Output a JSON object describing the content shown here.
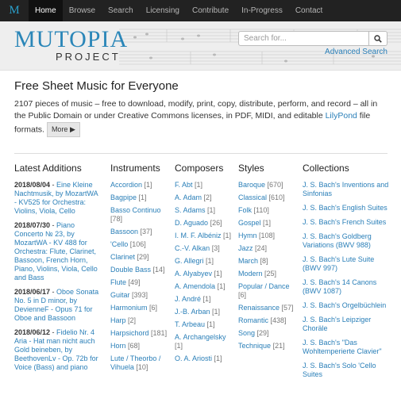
{
  "nav": {
    "brand": "M",
    "items": [
      {
        "label": "Home",
        "active": true
      },
      {
        "label": "Browse"
      },
      {
        "label": "Search"
      },
      {
        "label": "Licensing"
      },
      {
        "label": "Contribute"
      },
      {
        "label": "In-Progress"
      },
      {
        "label": "Contact"
      }
    ]
  },
  "header": {
    "logo_main": "MUTOPIA",
    "logo_sub": "PROJECT",
    "search_placeholder": "Search for...",
    "advanced_search": "Advanced Search"
  },
  "intro": {
    "title": "Free Sheet Music for Everyone",
    "text": "2107 pieces of music – free to download, modify, print, copy, distribute, perform, and record – all in the Public Domain or under Creative Commons licenses, in PDF, MIDI, and editable ",
    "link": "LilyPond",
    "text_end": " file formats.",
    "more": "More"
  },
  "latest": {
    "heading": "Latest Additions",
    "items": [
      {
        "date": "2018/08/04",
        "sep": " - ",
        "title": "Eine Kleine Nachtmusik, by MozartWA - KV525 for Orchestra: Violins, Viola, Cello"
      },
      {
        "date": "2018/07/30",
        "sep": " - ",
        "title": "Piano Concerto № 23, by MozartWA - KV 488 for Orchestra: Flute, Clarinet, Bassoon, French Horn, Piano, Violins, Viola, Cello and Bass"
      },
      {
        "date": "2018/06/17",
        "sep": " - ",
        "title": "Oboe Sonata No. 5 in D minor, by DevienneF - Opus 71 for Oboe and Bassoon"
      },
      {
        "date": "2018/06/12",
        "sep": " - ",
        "title": "Fidelio Nr. 4 Aria - Hat man nicht auch Gold beineben, by BeethovenLv - Op. 72b for Voice (Bass) and piano"
      }
    ]
  },
  "instruments": {
    "heading": "Instruments",
    "items": [
      {
        "name": "Accordion",
        "count": "[1]"
      },
      {
        "name": "Bagpipe",
        "count": "[1]"
      },
      {
        "name": "Basso Continuo",
        "count": "[78]"
      },
      {
        "name": "Bassoon",
        "count": "[37]"
      },
      {
        "name": "'Cello",
        "count": "[106]"
      },
      {
        "name": "Clarinet",
        "count": "[29]"
      },
      {
        "name": "Double Bass",
        "count": "[14]"
      },
      {
        "name": "Flute",
        "count": "[49]"
      },
      {
        "name": "Guitar",
        "count": "[393]"
      },
      {
        "name": "Harmonium",
        "count": "[6]"
      },
      {
        "name": "Harp",
        "count": "[2]"
      },
      {
        "name": "Harpsichord",
        "count": "[181]"
      },
      {
        "name": "Horn",
        "count": "[68]"
      },
      {
        "name": "Lute / Theorbo / Vihuela",
        "count": "[10]"
      }
    ]
  },
  "composers": {
    "heading": "Composers",
    "items": [
      {
        "name": "F. Abt",
        "count": "[1]"
      },
      {
        "name": "A. Adam",
        "count": "[2]"
      },
      {
        "name": "S. Adams",
        "count": "[1]"
      },
      {
        "name": "D. Aguado",
        "count": "[26]"
      },
      {
        "name": "I. M. F. Albéniz",
        "count": "[1]"
      },
      {
        "name": "C.-V. Alkan",
        "count": "[3]"
      },
      {
        "name": "G. Allegri",
        "count": "[1]"
      },
      {
        "name": "A. Alyabyev",
        "count": "[1]"
      },
      {
        "name": "A. Amendola",
        "count": "[1]"
      },
      {
        "name": "J. André",
        "count": "[1]"
      },
      {
        "name": "J.-B. Arban",
        "count": "[1]"
      },
      {
        "name": "T. Arbeau",
        "count": "[1]"
      },
      {
        "name": "A. Archangelsky",
        "count": "[1]"
      },
      {
        "name": "O. A. Ariosti",
        "count": "[1]"
      }
    ]
  },
  "styles": {
    "heading": "Styles",
    "items": [
      {
        "name": "Baroque",
        "count": "[670]"
      },
      {
        "name": "Classical",
        "count": "[610]"
      },
      {
        "name": "Folk",
        "count": "[110]"
      },
      {
        "name": "Gospel",
        "count": "[1]"
      },
      {
        "name": "Hymn",
        "count": "[108]"
      },
      {
        "name": "Jazz",
        "count": "[24]"
      },
      {
        "name": "March",
        "count": "[8]"
      },
      {
        "name": "Modern",
        "count": "[25]"
      },
      {
        "name": "Popular / Dance",
        "count": "[6]"
      },
      {
        "name": "Renaissance",
        "count": "[57]"
      },
      {
        "name": "Romantic",
        "count": "[438]"
      },
      {
        "name": "Song",
        "count": "[29]"
      },
      {
        "name": "Technique",
        "count": "[21]"
      }
    ]
  },
  "collections": {
    "heading": "Collections",
    "items": [
      "J. S. Bach's Inventions and Sinfonias",
      "J. S. Bach's English Suites",
      "J. S. Bach's French Suites",
      "J. S. Bach's Goldberg Variations (BWV 988)",
      "J. S. Bach's Lute Suite (BWV 997)",
      "J. S. Bach's 14 Canons (BWV 1087)",
      "J. S. Bach's Orgelbüchlein",
      "J. S. Bach's Leipziger Choräle",
      "J. S. Bach's \"Das Wohltemperierte Clavier\"",
      "J. S. Bach's Solo 'Cello Suites"
    ]
  },
  "colors": {
    "link": "#2a7fb8",
    "nav_bg": "#222222",
    "header_bg": "#eeeeee"
  }
}
